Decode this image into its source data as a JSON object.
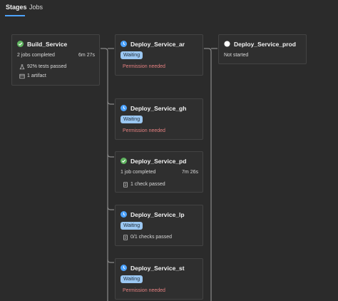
{
  "tabs": [
    {
      "label": "Stages",
      "active": true
    },
    {
      "label": "Jobs",
      "active": false
    }
  ],
  "colors": {
    "success": "#5fb45f",
    "waiting": "#4da3ff",
    "badge_bg": "#9bc7f2",
    "permission": "#e58080",
    "not_started": "#ffffff"
  },
  "stages": {
    "build": {
      "name": "Build_Service",
      "status": "success",
      "status_icon": "check-circle-icon",
      "summary": "2 jobs completed",
      "duration": "6m 27s",
      "tests": "92% tests passed",
      "tests_icon": "flask-icon",
      "artifacts": "1 artifact",
      "artifacts_icon": "artifact-icon"
    },
    "ar": {
      "name": "Deploy_Service_ar",
      "status": "waiting",
      "status_icon": "clock-circle-icon",
      "badge": "Waiting",
      "note": "Permission needed"
    },
    "gh": {
      "name": "Deploy_Service_gh",
      "status": "waiting",
      "status_icon": "clock-circle-icon",
      "badge": "Waiting",
      "note": "Permission needed"
    },
    "pd": {
      "name": "Deploy_Service_pd",
      "status": "success",
      "status_icon": "check-circle-icon",
      "summary": "1 job completed",
      "duration": "7m 26s",
      "checks": "1 check passed",
      "checks_icon": "checklist-icon"
    },
    "lp": {
      "name": "Deploy_Service_lp",
      "status": "waiting",
      "status_icon": "clock-circle-icon",
      "badge": "Waiting",
      "checks": "0/1 checks passed",
      "checks_icon": "checklist-icon"
    },
    "st": {
      "name": "Deploy_Service_st",
      "status": "waiting",
      "status_icon": "clock-circle-icon",
      "badge": "Waiting",
      "note": "Permission needed"
    },
    "prod": {
      "name": "Deploy_Service_prod",
      "status": "not-started",
      "status_icon": "empty-circle-icon",
      "summary": "Not started"
    }
  }
}
